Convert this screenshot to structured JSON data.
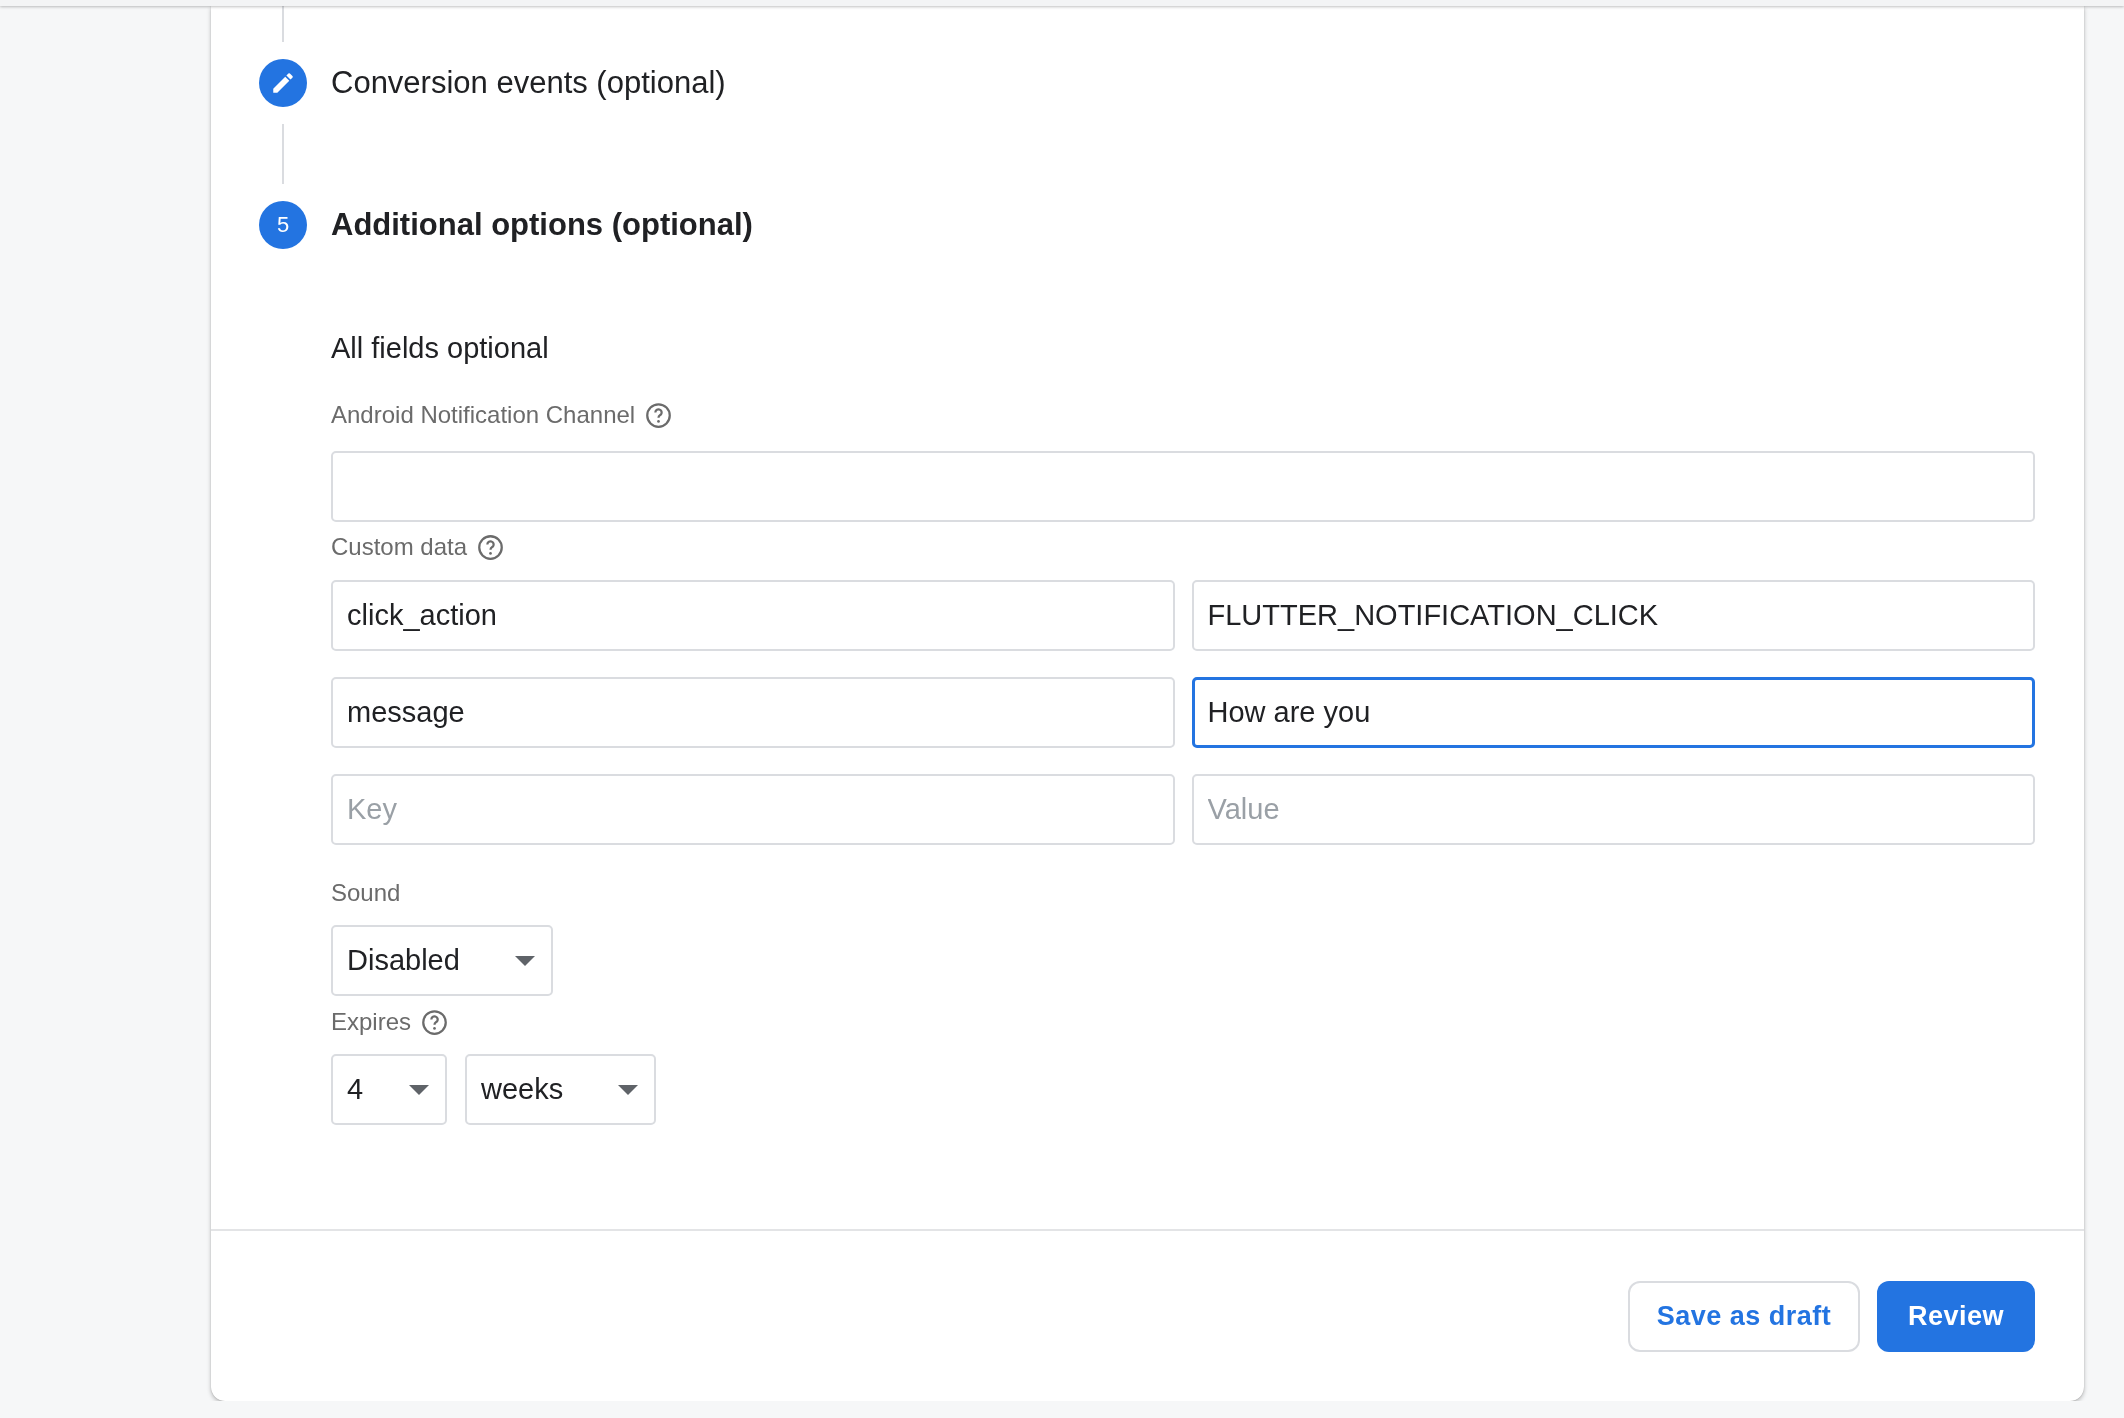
{
  "steps": [
    {
      "kind": "edit",
      "label": "Conversion events (optional)",
      "active": false
    },
    {
      "kind": "number",
      "number": "5",
      "label": "Additional options (optional)",
      "active": true
    }
  ],
  "section": {
    "heading": "All fields optional",
    "channel": {
      "label": "Android Notification Channel",
      "help": true
    },
    "custom_data": {
      "label": "Custom data",
      "help": true,
      "rows": [
        {
          "key": {
            "value": "click_action",
            "focused": false
          },
          "value": {
            "value": "FLUTTER_NOTIFICATION_CLICK",
            "focused": false
          }
        },
        {
          "key": {
            "value": "message",
            "focused": false
          },
          "value": {
            "value": "How are you",
            "focused": true
          }
        },
        {
          "key": {
            "placeholder": "Key",
            "focused": false
          },
          "value": {
            "placeholder": "Value",
            "focused": false
          }
        }
      ]
    },
    "sound": {
      "label": "Sound",
      "value": "Disabled"
    },
    "expires": {
      "label": "Expires",
      "help": true,
      "amount": "4",
      "unit": "weeks"
    }
  },
  "buttons": [
    {
      "label": "Save as draft",
      "kind": "outlined"
    },
    {
      "label": "Review",
      "kind": "filled"
    }
  ]
}
